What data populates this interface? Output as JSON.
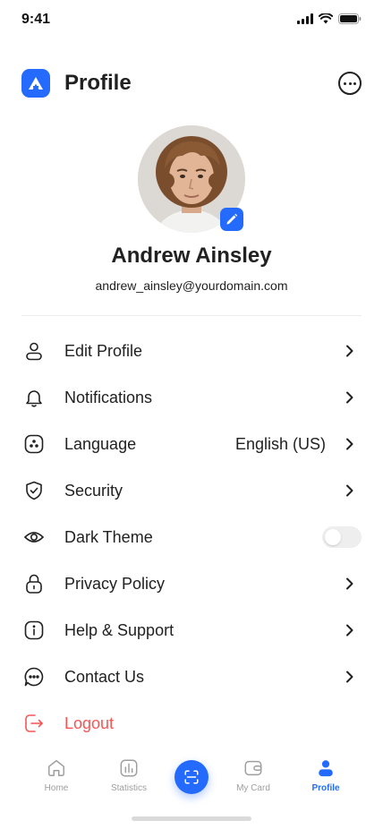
{
  "status_bar": {
    "time": "9:41"
  },
  "header": {
    "title": "Profile"
  },
  "profile": {
    "name": "Andrew Ainsley",
    "email": "andrew_ainsley@yourdomain.com"
  },
  "menu": {
    "edit_profile": {
      "label": "Edit Profile"
    },
    "notifications": {
      "label": "Notifications"
    },
    "language": {
      "label": "Language",
      "value": "English (US)"
    },
    "security": {
      "label": "Security"
    },
    "dark_theme": {
      "label": "Dark Theme",
      "enabled": false
    },
    "privacy_policy": {
      "label": "Privacy Policy"
    },
    "help_support": {
      "label": "Help & Support"
    },
    "contact_us": {
      "label": "Contact Us"
    },
    "logout": {
      "label": "Logout"
    }
  },
  "bottom_nav": {
    "home": "Home",
    "statistics": "Statistics",
    "my_card": "My Card",
    "profile": "Profile",
    "active": "profile"
  },
  "colors": {
    "accent": "#246BFD",
    "danger": "#F75555",
    "text": "#212121",
    "inactive": "#9E9E9E"
  },
  "icons": {
    "logo": "logo-icon",
    "more": "more-icon",
    "edit": "pencil-icon",
    "scan": "scan-icon"
  }
}
